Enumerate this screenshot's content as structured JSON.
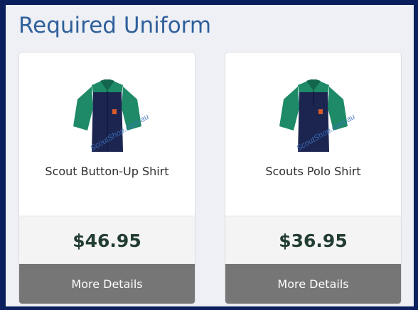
{
  "section": {
    "title": "Required Uniform"
  },
  "products": [
    {
      "name": "Scout Button-Up Shirt",
      "price": "$46.95",
      "button_label": "More Details",
      "watermark": "ScoutShop.com.au",
      "image": "shirt-icon"
    },
    {
      "name": "Scouts Polo Shirt",
      "price": "$36.95",
      "button_label": "More Details",
      "watermark": "ScoutShop.com.au",
      "image": "polo-shirt-icon"
    }
  ],
  "colors": {
    "frame": "#0b1f5c",
    "title": "#2f5f9a",
    "shirt_body": "#1b2550",
    "shirt_accent": "#1e8a67",
    "price_text": "#223d31",
    "details_button": "#767676"
  }
}
